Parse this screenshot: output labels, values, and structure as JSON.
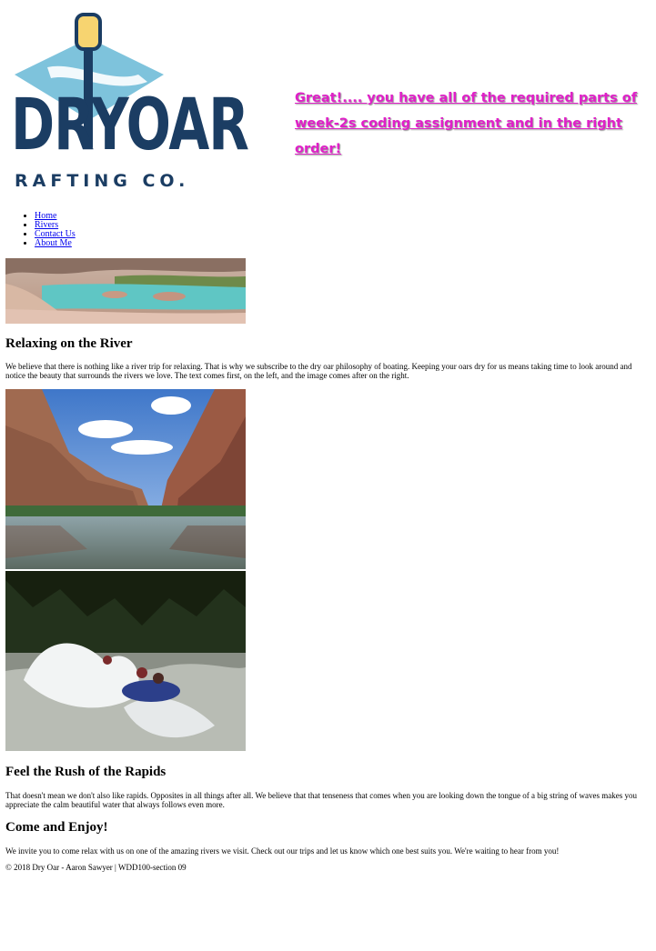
{
  "header": {
    "logo": {
      "name": "dry-oar-logo",
      "wordmark": "DRYOAR",
      "tagline": "RAFTING CO.",
      "colors": {
        "navy": "#1b3d63",
        "sky": "#7ec3dc",
        "blade": "#f7d470"
      }
    },
    "banner": "Great!.... you have all of the required parts of week-2s coding assignment and in the right order!",
    "banner_color": "#e020c8"
  },
  "nav": {
    "items": [
      {
        "label": "Home"
      },
      {
        "label": "Rivers"
      },
      {
        "label": "Contact Us"
      },
      {
        "label": "About Me"
      }
    ]
  },
  "sections": [
    {
      "heading": "Relaxing on the River",
      "text": "We believe that there is nothing like a river trip for relaxing. That is why we subscribe to the dry oar philosophy of boating. Keeping your oars dry for us means taking time to look around and notice the beauty that surrounds the rivers we love. The text comes first, on the left, and the image comes after on the right."
    },
    {
      "heading": "Feel the Rush of the Rapids",
      "text": "That doesn't mean we don't also like rapids. Opposites in all things after all. We believe that that tenseness that comes when you are looking down the tongue of a big string of waves makes you appreciate the calm beautiful water that always follows even more."
    },
    {
      "heading": "Come and Enjoy!",
      "text": "We invite you to come relax with us on one of the amazing rivers we visit. Check out our trips and let us know which one best suits you. We're waiting to hear from you!"
    }
  ],
  "footer": {
    "text": "© 2018 Dry Oar - Aaron Sawyer | WDD100-section 09"
  }
}
